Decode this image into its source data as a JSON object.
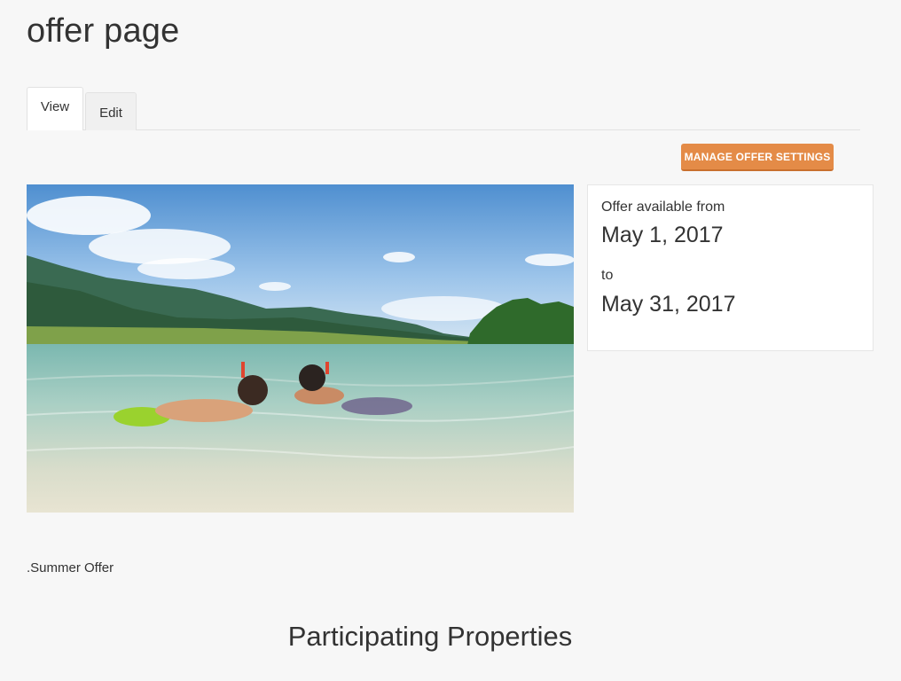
{
  "page": {
    "title": "offer page"
  },
  "tabs": [
    {
      "label": "View",
      "active": true
    },
    {
      "label": "Edit",
      "active": false
    }
  ],
  "actions": {
    "manage_label": "MANAGE OFFER SETTINGS",
    "manage_color": "#e48b47"
  },
  "availability": {
    "from_label": "Offer available from",
    "from_date": "May 1, 2017",
    "to_label": "to",
    "to_date": "May 31, 2017"
  },
  "content": {
    "caption": ".Summer Offer",
    "section_heading": "Participating Properties"
  }
}
